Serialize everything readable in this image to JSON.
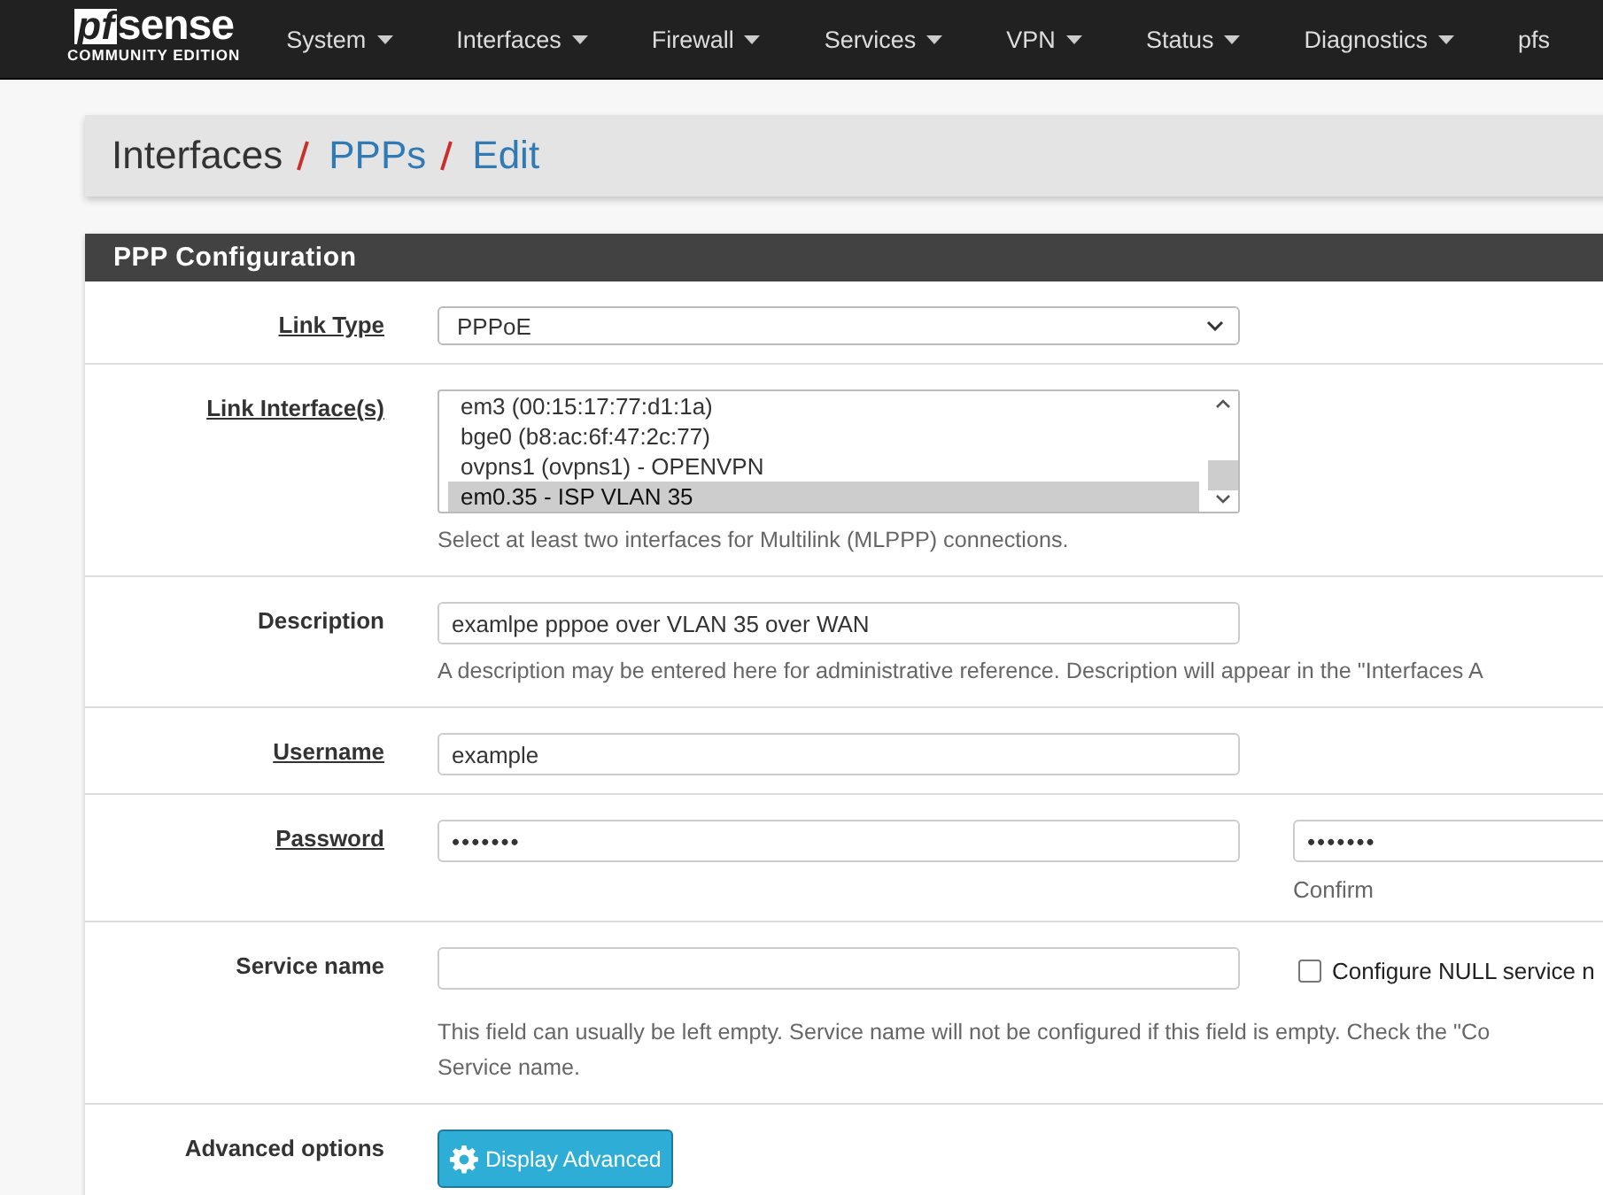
{
  "navbar": {
    "logo": {
      "brand_left": "pf",
      "brand_right": "sense",
      "edition": "COMMUNITY EDITION"
    },
    "menu": [
      {
        "label": "System",
        "caret": true
      },
      {
        "label": "Interfaces",
        "caret": true
      },
      {
        "label": "Firewall",
        "caret": true
      },
      {
        "label": "Services",
        "caret": true
      },
      {
        "label": "VPN",
        "caret": true
      },
      {
        "label": "Status",
        "caret": true
      },
      {
        "label": "Diagnostics",
        "caret": true
      },
      {
        "label": "pfs",
        "caret": false
      }
    ]
  },
  "breadcrumb": [
    {
      "label": "Interfaces",
      "link": false
    },
    {
      "label": "PPPs",
      "link": true
    },
    {
      "label": "Edit",
      "link": true
    }
  ],
  "panel": {
    "title": "PPP Configuration",
    "rows": [
      {
        "kind": "select",
        "label": "Link Type",
        "required": true,
        "value": "PPPoE"
      },
      {
        "kind": "multiselect",
        "label": "Link Interface(s)",
        "required": true,
        "options": [
          {
            "label": "em3 (00:15:17:77:d1:1a)",
            "selected": false
          },
          {
            "label": "bge0 (b8:ac:6f:47:2c:77)",
            "selected": false
          },
          {
            "label": "ovpns1 (ovpns1) - OPENVPN",
            "selected": false
          },
          {
            "label": "em0.35 - ISP VLAN 35",
            "selected": true
          }
        ],
        "help": "Select at least two interfaces for Multilink (MLPPP) connections."
      },
      {
        "kind": "text",
        "label": "Description",
        "required": false,
        "value": "examlpe pppoe over VLAN 35 over WAN",
        "help": "A description may be entered here for administrative reference. Description will appear in the \"Interfaces A"
      },
      {
        "kind": "text",
        "label": "Username",
        "required": true,
        "value": "example"
      },
      {
        "kind": "password",
        "label": "Password",
        "required": true,
        "value": "•••••••",
        "confirm_value": "•••••••",
        "confirm_label": "Confirm"
      },
      {
        "kind": "service",
        "label": "Service name",
        "required": false,
        "value": "",
        "checkbox_label": "Configure NULL service n",
        "checked": false,
        "help": "This field can usually be left empty. Service name will not be configured if this field is empty. Check the \"Co\nService name."
      },
      {
        "kind": "button",
        "label": "Advanced options",
        "required": false,
        "button_label": "Display Advanced"
      }
    ]
  }
}
